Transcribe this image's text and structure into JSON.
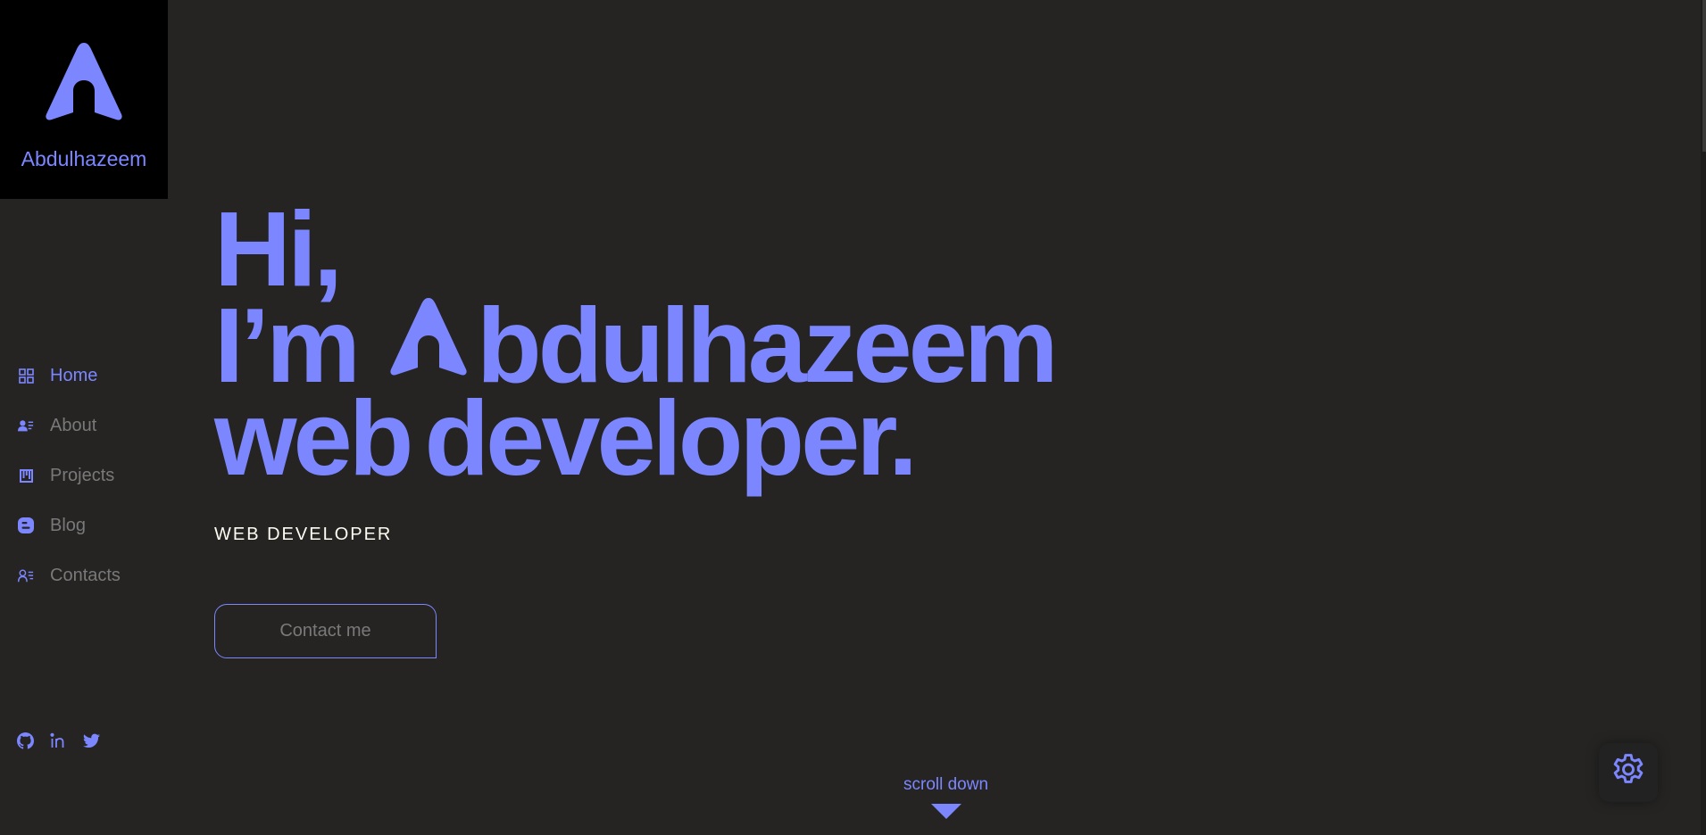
{
  "brand": {
    "name": "Abdulhazeem",
    "logo_icon": "arrow-a-logo-icon"
  },
  "nav": {
    "items": [
      {
        "label": "Home",
        "icon": "grid-icon",
        "active": true
      },
      {
        "label": "About",
        "icon": "user-card-icon",
        "active": false
      },
      {
        "label": "Projects",
        "icon": "kanban-icon",
        "active": false
      },
      {
        "label": "Blog",
        "icon": "blog-icon",
        "active": false
      },
      {
        "label": "Contacts",
        "icon": "contacts-icon",
        "active": false
      }
    ]
  },
  "socials": [
    "github-icon",
    "linkedin-icon",
    "twitter-icon"
  ],
  "hero": {
    "line1": "Hi,",
    "line2_prefix": "I’m",
    "line2_name_rest": "bdulhazeem",
    "line3_word1": "web",
    "line3_word2": "developer."
  },
  "subtitle": "WEB DEVELOPER",
  "contact_button": "Contact me",
  "scroll": {
    "label": "scroll down",
    "icon": "triangle-down-icon"
  },
  "settings_icon": "gear-icon",
  "colors": {
    "accent": "#7c87ff",
    "background": "#252423",
    "logo_bg": "#000000",
    "muted_text": "#7a7979",
    "subtitle_text": "#fffdf2"
  }
}
